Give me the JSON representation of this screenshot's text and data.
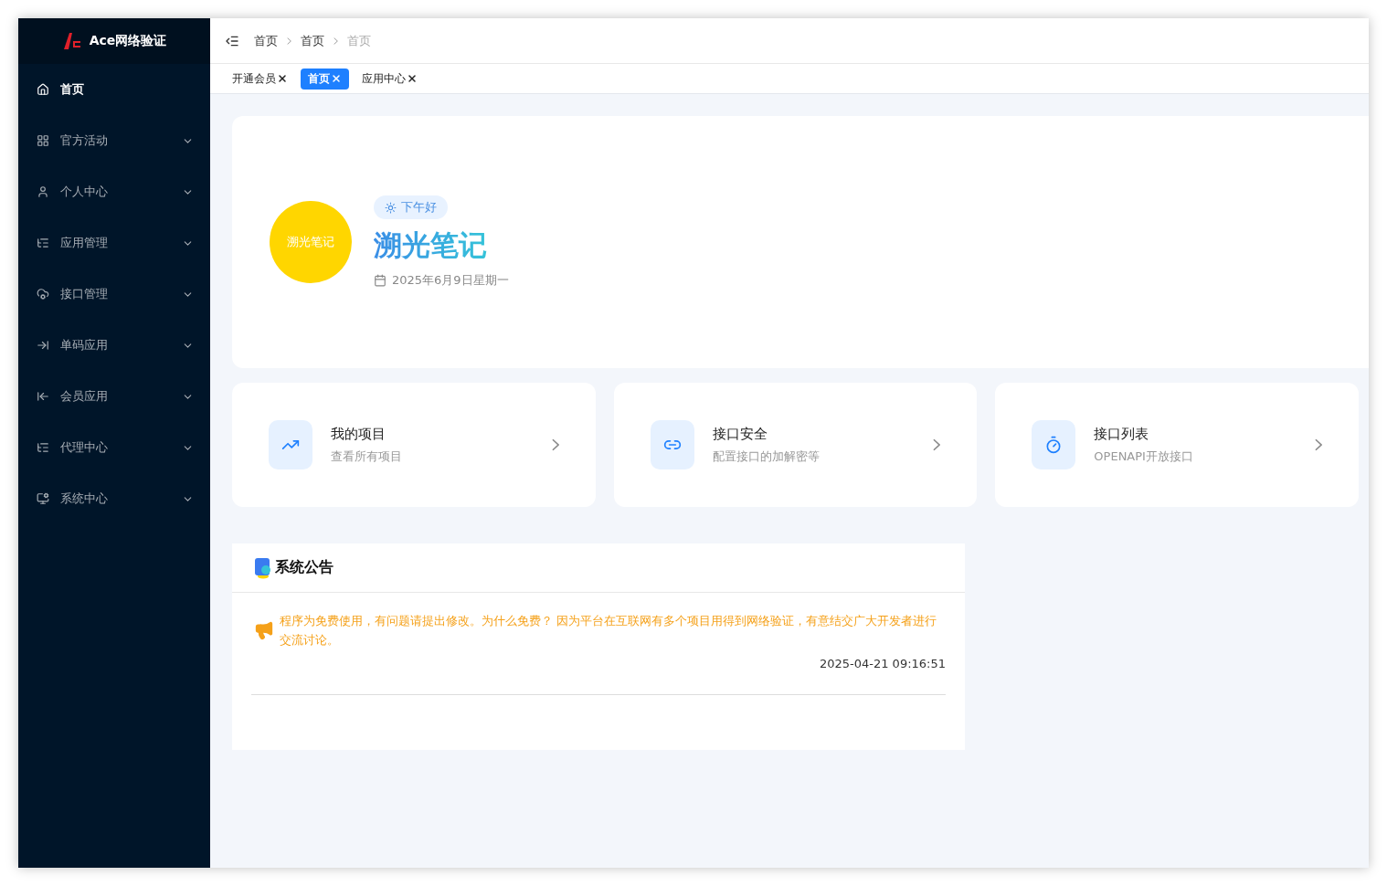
{
  "sidebar": {
    "logo_text": "Ace网络验证",
    "items": [
      {
        "label": "首页",
        "kind": "link",
        "selected": true
      },
      {
        "label": "官方活动",
        "kind": "group",
        "selected": false
      },
      {
        "label": "个人中心",
        "kind": "group",
        "selected": false
      },
      {
        "label": "应用管理",
        "kind": "group",
        "selected": false
      },
      {
        "label": "接口管理",
        "kind": "group",
        "selected": false
      },
      {
        "label": "单码应用",
        "kind": "group",
        "selected": false
      },
      {
        "label": "会员应用",
        "kind": "group",
        "selected": false
      },
      {
        "label": "代理中心",
        "kind": "group",
        "selected": false
      },
      {
        "label": "系统中心",
        "kind": "group",
        "selected": false
      }
    ]
  },
  "breadcrumb": [
    "首页",
    "首页",
    "首页"
  ],
  "tabs": [
    {
      "label": "开通会员",
      "selected": false
    },
    {
      "label": "首页",
      "selected": true
    },
    {
      "label": "应用中心",
      "selected": false
    }
  ],
  "welcome": {
    "avatar_text": "溯光笔记",
    "greeting": "下午好",
    "name": "溯光笔记",
    "date": "2025年6月9日星期一"
  },
  "shortcuts": [
    {
      "title": "我的项目",
      "subtitle": "查看所有项目"
    },
    {
      "title": "接口安全",
      "subtitle": "配置接口的加解密等"
    },
    {
      "title": "接口列表",
      "subtitle": "OPENAPI开放接口"
    }
  ],
  "notice": {
    "title": "系统公告",
    "items": [
      {
        "text": "程序为免费使用，有问题请提出修改。为什么免费？ 因为平台在互联网有多个项目用得到网络验证，有意结交广大开发者进行交流讨论。",
        "time": "2025-04-21 09:16:51"
      }
    ]
  }
}
